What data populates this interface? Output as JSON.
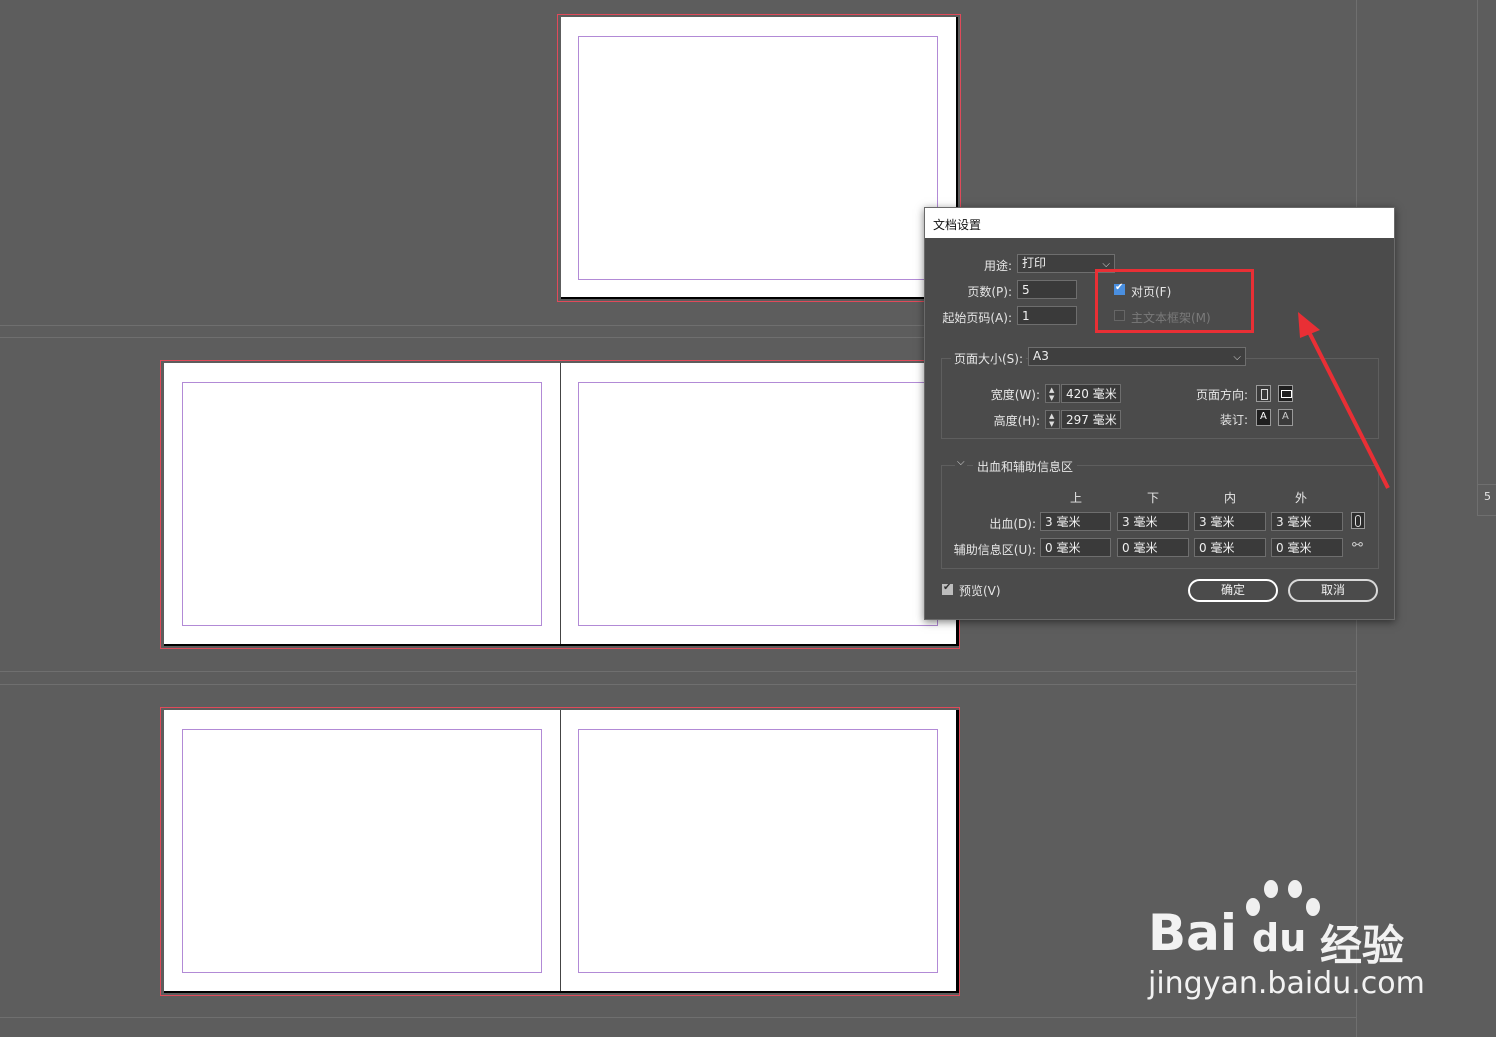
{
  "dialog": {
    "title": "文档设置",
    "intent_label": "用途:",
    "intent_value": "打印",
    "pages_label": "页数(P):",
    "pages_value": "5",
    "start_page_label": "起始页码(A):",
    "start_page_value": "1",
    "facing_pages_label": "对页(F)",
    "facing_pages_checked": true,
    "primary_text_frame_label": "主文本框架(M)",
    "primary_text_frame_checked": false,
    "page_size_label": "页面大小(S):",
    "page_size_value": "A3",
    "width_label": "宽度(W):",
    "width_value": "420 毫米",
    "height_label": "高度(H):",
    "height_value": "297 毫米",
    "orientation_label": "页面方向:",
    "binding_label": "装订:",
    "bleed_section_title": "出血和辅助信息区",
    "columns": [
      "上",
      "下",
      "内",
      "外"
    ],
    "bleed_label": "出血(D):",
    "bleed_values": [
      "3 毫米",
      "3 毫米",
      "3 毫米",
      "3 毫米"
    ],
    "slug_label": "辅助信息区(U):",
    "slug_values": [
      "0 毫米",
      "0 毫米",
      "0 毫米",
      "0 毫米"
    ],
    "preview_label": "预览(V)",
    "preview_checked": true,
    "ok_label": "确定",
    "cancel_label": "取消"
  },
  "side_panel_number": "5",
  "watermark": {
    "logo_text": "Bai",
    "logo_text2": "du",
    "brand_text": "经验",
    "url_text": "jingyan.baidu.com"
  },
  "colors": {
    "workspace": "#5d5d5d",
    "dialog_bg": "#4b4b4b",
    "bleed_guide": "#e04a5a",
    "margin_guide": "#b28ad6",
    "highlight": "#e92f35",
    "checkbox_accent": "#4a8fe0"
  }
}
